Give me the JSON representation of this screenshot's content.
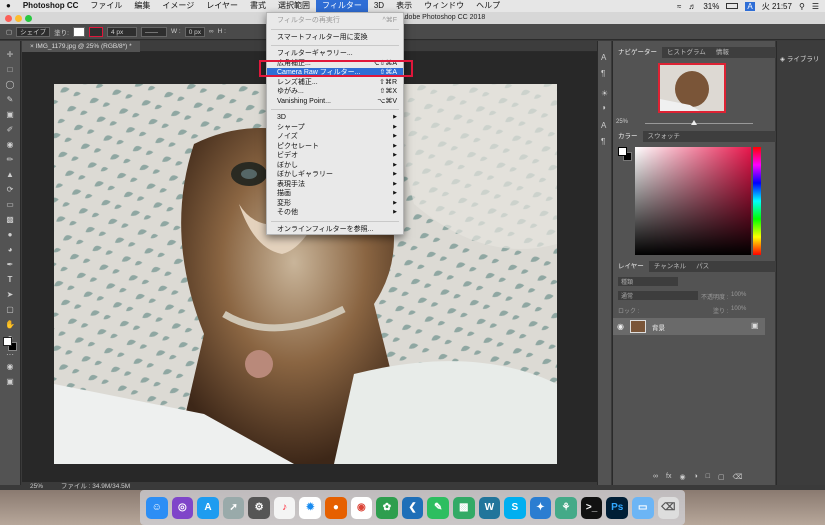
{
  "menubar": {
    "apple": "",
    "app": "Photoshop CC",
    "items": [
      "ファイル",
      "編集",
      "イメージ",
      "レイヤー",
      "書式",
      "選択範囲",
      "フィルター",
      "3D",
      "表示",
      "ウィンドウ",
      "ヘルプ"
    ],
    "active_index": 6,
    "battery": "31%",
    "input": "A",
    "clock": "火 21:57"
  },
  "window": {
    "title": "Adobe Photoshop CC 2018"
  },
  "options": {
    "tool": "シェイプ",
    "fill": "塗り:",
    "stroke_width": "4 px",
    "w_label": "W :",
    "w_value": "0 px",
    "h_label": "H :"
  },
  "document": {
    "tab": "IMG_1179.jpg @ 25% (RGB/8*) *"
  },
  "status": {
    "zoom": "25%",
    "file": "ファイル : 34.9M/34.5M"
  },
  "filter_menu": {
    "items": [
      {
        "label": "フィルターの再実行",
        "shortcut": "^⌘F",
        "disabled": true
      },
      {
        "sep": true
      },
      {
        "label": "スマートフィルター用に変換",
        "shortcut": ""
      },
      {
        "sep": true
      },
      {
        "label": "フィルターギャラリー...",
        "shortcut": ""
      },
      {
        "label": "広角補正...",
        "shortcut": "⌥⇧⌘A"
      },
      {
        "label": "Camera Raw フィルター...",
        "shortcut": "⇧⌘A",
        "highlight": true
      },
      {
        "label": "レンズ補正...",
        "shortcut": "⇧⌘R"
      },
      {
        "label": "ゆがみ...",
        "shortcut": "⇧⌘X"
      },
      {
        "label": "Vanishing Point...",
        "shortcut": "⌥⌘V"
      },
      {
        "sep": true
      },
      {
        "label": "3D",
        "sub": true
      },
      {
        "label": "シャープ",
        "sub": true
      },
      {
        "label": "ノイズ",
        "sub": true
      },
      {
        "label": "ピクセレート",
        "sub": true
      },
      {
        "label": "ビデオ",
        "sub": true
      },
      {
        "label": "ぼかし",
        "sub": true
      },
      {
        "label": "ぼかしギャラリー",
        "sub": true
      },
      {
        "label": "表現手法",
        "sub": true
      },
      {
        "label": "描画",
        "sub": true
      },
      {
        "label": "変形",
        "sub": true
      },
      {
        "label": "その他",
        "sub": true
      },
      {
        "sep": true
      },
      {
        "label": "オンラインフィルターを参照...",
        "shortcut": ""
      }
    ]
  },
  "navigator": {
    "tabs": [
      "ナビゲーター",
      "ヒストグラム",
      "情報"
    ],
    "zoom": "25%"
  },
  "color": {
    "tabs": [
      "カラー",
      "スウォッチ"
    ]
  },
  "layers": {
    "tabs": [
      "レイヤー",
      "チャンネル",
      "パス"
    ],
    "kind": "種類",
    "mode": "通常",
    "opacity_label": "不透明度 :",
    "opacity_value": "100%",
    "lock_label": "ロック :",
    "fill_label": "塗り :",
    "fill_value": "100%",
    "layer_name": "背景"
  },
  "library": {
    "label": "ライブラリ"
  },
  "colors": {
    "highlight": "#2f6ed6",
    "annotation": "#e0173b"
  }
}
